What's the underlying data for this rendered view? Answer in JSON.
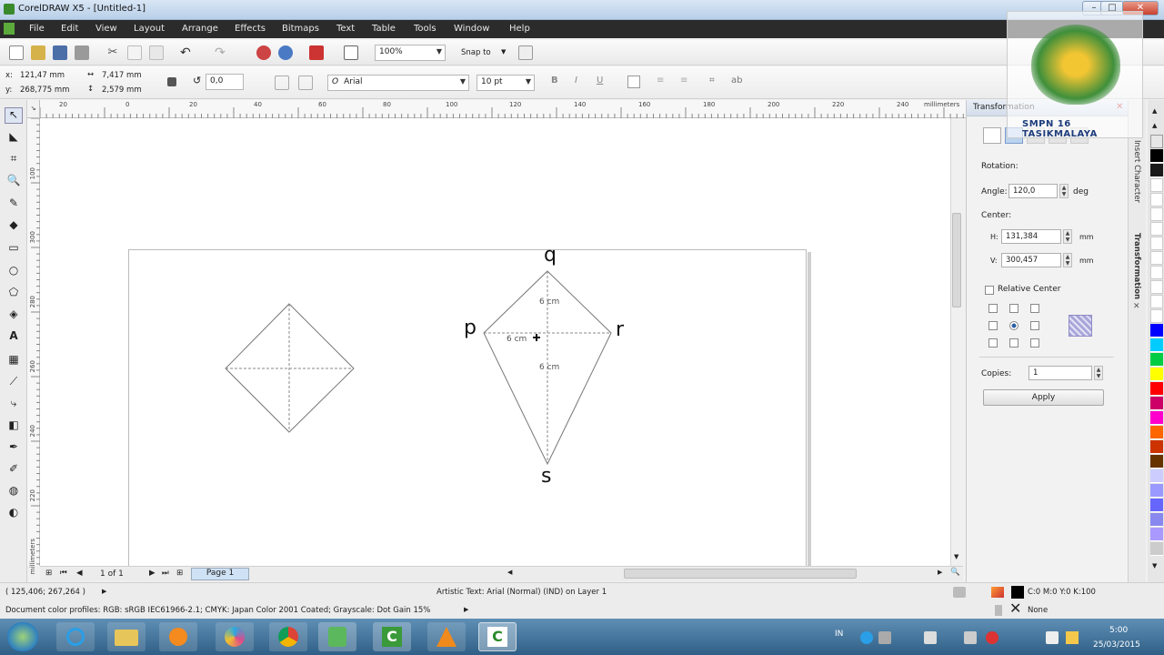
{
  "window": {
    "title": "CorelDRAW X5 - [Untitled-1]"
  },
  "menu": [
    "File",
    "Edit",
    "View",
    "Layout",
    "Arrange",
    "Effects",
    "Bitmaps",
    "Text",
    "Table",
    "Tools",
    "Window",
    "Help"
  ],
  "toolbar": {
    "zoom": "100%",
    "snap": "Snap to"
  },
  "propbar": {
    "x": "121,47 mm",
    "y": "268,775 mm",
    "w": "7,417 mm",
    "h": "2,579 mm",
    "angle": "0,0",
    "font": "Arial",
    "size": "10 pt"
  },
  "ruler": {
    "h_ticks": [
      "20",
      "0",
      "20",
      "40",
      "60",
      "80",
      "100",
      "120",
      "140",
      "160",
      "180",
      "200",
      "220",
      "240"
    ],
    "units": "millimeters",
    "v_ticks": [
      "100",
      "300",
      "280",
      "260",
      "240",
      "220"
    ],
    "v_units": "millimeters"
  },
  "drawing": {
    "points": {
      "q": "q",
      "p": "p",
      "r": "r",
      "s": "s"
    },
    "labels": {
      "top": "6 cm",
      "left": "6 cm",
      "bottom": "6 cm"
    }
  },
  "pagebar": {
    "count": "1 of 1",
    "tab": "Page 1"
  },
  "docker": {
    "title": "Transformation",
    "rotation_label": "Rotation:",
    "angle_label": "Angle:",
    "angle_value": "120,0",
    "angle_unit": "deg",
    "center_label": "Center:",
    "h_label": "H:",
    "h_value": "131,384",
    "v_label": "V:",
    "v_value": "300,457",
    "unit": "mm",
    "relative_center": "Relative Center",
    "copies_label": "Copies:",
    "copies_value": "1",
    "apply": "Apply"
  },
  "docker_tabs": [
    "Insert Character",
    "Transformation"
  ],
  "status": {
    "coords": "( 125,406; 267,264 )",
    "object": "Artistic Text: Arial (Normal) (IND) on Layer 1",
    "profiles": "Document color profiles: RGB: sRGB IEC61966-2.1; CMYK: Japan Color 2001 Coated; Grayscale: Dot Gain 15%",
    "fill": "C:0 M:0 Y:0 K:100",
    "outline": "None"
  },
  "watermark": "SMPN 16 TASIKMALAYA",
  "clock": {
    "time": "5:00",
    "date": "25/03/2015"
  },
  "palette": [
    "#ffffff",
    "#000000",
    "#1a1a1a",
    "#ffffff",
    "#0000ff",
    "#00aaff",
    "#00ffff",
    "#00cc00",
    "#ffff00",
    "#ff0000",
    "#cc0066",
    "#ff00ff",
    "#990099",
    "#ff6600",
    "#cc3300",
    "#663300",
    "#ffcc00",
    "#cc99ff",
    "#9999ff",
    "#6666ff",
    "#3366cc",
    "#cccccc"
  ]
}
